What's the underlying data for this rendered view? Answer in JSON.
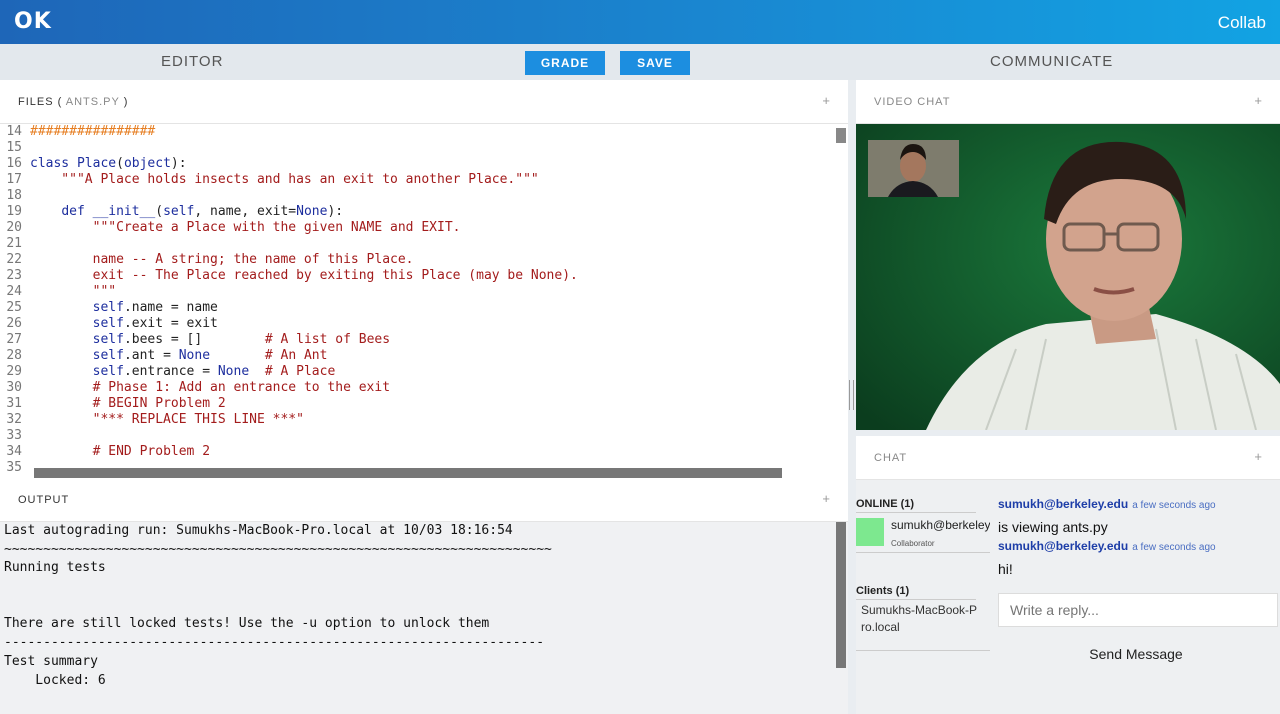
{
  "header": {
    "logo": "OK",
    "collab": "Collab"
  },
  "subbar": {
    "editor": "EDITOR",
    "communicate": "COMMUNICATE",
    "grade": "GRADE",
    "save": "SAVE"
  },
  "files": {
    "label": "FILES (",
    "file": "ANTS.PY",
    "close": ")",
    "plus": "+"
  },
  "code_lines": [
    {
      "n": "14",
      "t": "################"
    },
    {
      "n": "15",
      "t": ""
    },
    {
      "n": "16",
      "t": "class Place(object):"
    },
    {
      "n": "17",
      "t": "    \"\"\"A Place holds insects and has an exit to another Place.\"\"\""
    },
    {
      "n": "18",
      "t": ""
    },
    {
      "n": "19",
      "t": "    def __init__(self, name, exit=None):"
    },
    {
      "n": "20",
      "t": "        \"\"\"Create a Place with the given NAME and EXIT."
    },
    {
      "n": "21",
      "t": ""
    },
    {
      "n": "22",
      "t": "        name -- A string; the name of this Place."
    },
    {
      "n": "23",
      "t": "        exit -- The Place reached by exiting this Place (may be None)."
    },
    {
      "n": "24",
      "t": "        \"\"\""
    },
    {
      "n": "25",
      "t": "        self.name = name"
    },
    {
      "n": "26",
      "t": "        self.exit = exit"
    },
    {
      "n": "27",
      "t": "        self.bees = []        # A list of Bees"
    },
    {
      "n": "28",
      "t": "        self.ant = None       # An Ant"
    },
    {
      "n": "29",
      "t": "        self.entrance = None  # A Place"
    },
    {
      "n": "30",
      "t": "        # Phase 1: Add an entrance to the exit"
    },
    {
      "n": "31",
      "t": "        # BEGIN Problem 2"
    },
    {
      "n": "32",
      "t": "        \"*** REPLACE THIS LINE ***\""
    },
    {
      "n": "33",
      "t": ""
    },
    {
      "n": "34",
      "t": "        # END Problem 2"
    },
    {
      "n": "35",
      "t": ""
    }
  ],
  "output": {
    "label": "OUTPUT",
    "plus": "+",
    "lines": [
      "Last autograding run: Sumukhs-MacBook-Pro.local at 10/03 18:16:54",
      "~~~~~~~~~~~~~~~~~~~~~~~~~~~~~~~~~~~~~~~~~~~~~~~~~~~~~~~~~~~~~~~~~~~~~~",
      "Running tests",
      "",
      "",
      "There are still locked tests! Use the -u option to unlock them",
      "---------------------------------------------------------------------",
      "Test summary",
      "    Locked: 6",
      ""
    ]
  },
  "video": {
    "label": "VIDEO CHAT",
    "plus": "+"
  },
  "chat": {
    "label": "CHAT",
    "plus": "+",
    "online_label": "ONLINE (1)",
    "online_user": "sumukh@berkeley",
    "online_role": "Collaborator",
    "clients_label": "Clients (1)",
    "client_name": "Sumukhs-MacBook-Pro.local",
    "messages": [
      {
        "from": "sumukh@berkeley.edu",
        "time": "a few seconds ago",
        "text": "is viewing ants.py"
      },
      {
        "from": "sumukh@berkeley.edu",
        "time": "a few seconds ago",
        "text": "hi!"
      }
    ],
    "reply_placeholder": "Write a reply...",
    "send_label": "Send Message"
  },
  "colors": {
    "accent": "#1c8ee0",
    "header_start": "#1e66b8",
    "header_end": "#12a3e3",
    "online_dot": "#7de88f",
    "video_bg": "#105a2c"
  }
}
